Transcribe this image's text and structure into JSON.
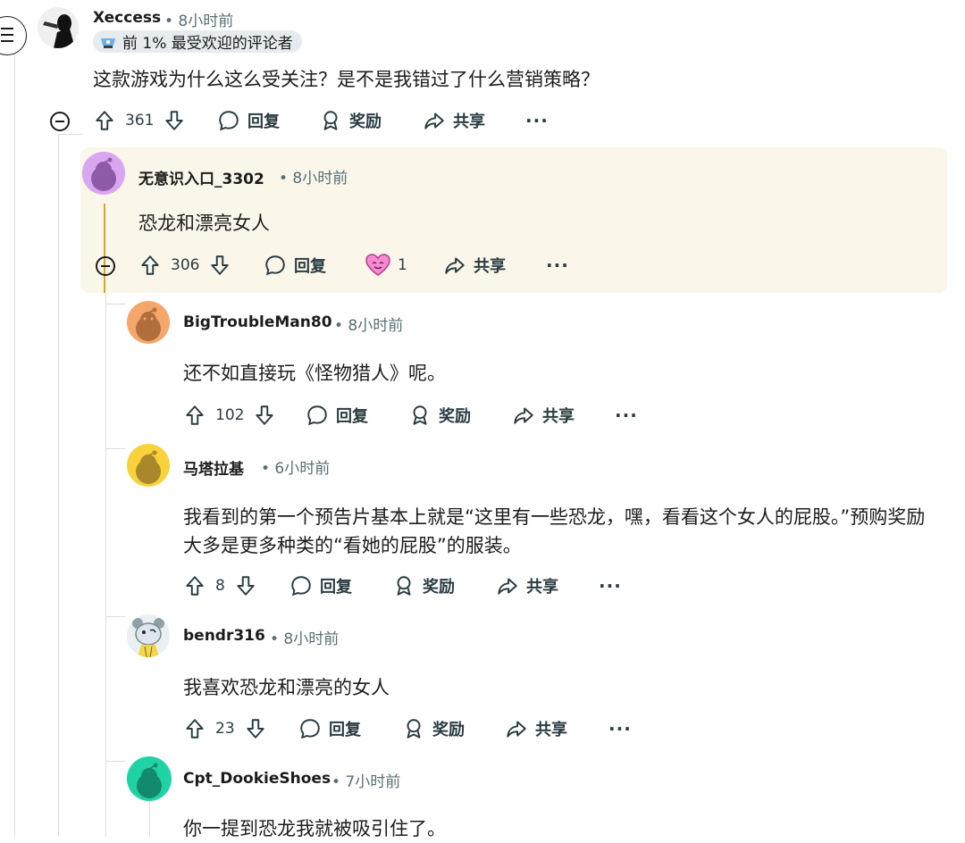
{
  "menu": {
    "icon": "hamburger-menu-icon"
  },
  "comments": [
    {
      "user": "Xeccess",
      "time": "• 8小时前",
      "badge": "前 1% 最受欢迎的评论者",
      "text": "这款游戏为什么这么受关注？是不是我错过了什么营销策略？",
      "votes": "361",
      "reply": "回复",
      "award": "奖励",
      "share": "共享",
      "more": "···"
    },
    {
      "user": "无意识入口_3302",
      "time": "• 8小时前",
      "text": "恐龙和漂亮女人",
      "votes": "306",
      "reply": "回复",
      "award_count": "1",
      "share": "共享",
      "more": "···",
      "highlight_color": "#fbf6ea"
    },
    {
      "user": "BigTroubleMan80",
      "time": "• 8小时前",
      "text": "还不如直接玩《怪物猎人》呢。",
      "votes": "102",
      "reply": "回复",
      "award": "奖励",
      "share": "共享",
      "more": "···"
    },
    {
      "user": "马塔拉基",
      "time": "• 6小时前",
      "text": "我看到的第一个预告片基本上就是“这里有一些恐龙，嘿，看看这个女人的屁股。”预购奖励大多是更多种类的“看她的屁股”的服装。",
      "votes": "8",
      "reply": "回复",
      "award": "奖励",
      "share": "共享",
      "more": "···"
    },
    {
      "user": "bendr316",
      "time": "• 8小时前",
      "text": "我喜欢恐龙和漂亮的女人",
      "votes": "23",
      "reply": "回复",
      "award": "奖励",
      "share": "共享",
      "more": "···"
    },
    {
      "user": "Cpt_DookieShoes",
      "time": "• 7小时前",
      "text": "你一提到恐龙我就被吸引住了。"
    }
  ],
  "colors": {
    "accent_line": "#d4a72c",
    "avatar_purple": "#d9a6f0",
    "avatar_orange": "#f5a66a",
    "avatar_yellow": "#f8d23a",
    "avatar_teal": "#1fd3a5"
  }
}
